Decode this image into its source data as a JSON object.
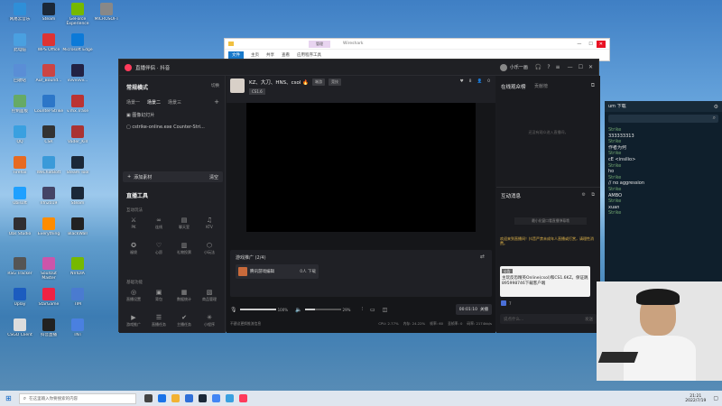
{
  "desktop_icons": [
    {
      "label": "网易云音乐"
    },
    {
      "label": "Steam"
    },
    {
      "label": "GeForce Experience"
    },
    {
      "label": "MICROSOFT"
    },
    {
      "label": "此电脑"
    },
    {
      "label": "WPS Office"
    },
    {
      "label": "Microsoft Edge"
    },
    {
      "label": "回收站"
    },
    {
      "label": "Aur_Bound..."
    },
    {
      "label": "vvvvvvv..."
    },
    {
      "label": "控制面板"
    },
    {
      "label": "Counter-Strike"
    },
    {
      "label": "v.mx.Trase"
    },
    {
      "label": "QQ"
    },
    {
      "label": "CSR"
    },
    {
      "label": "Vader_Kill"
    },
    {
      "label": "Firefox"
    },
    {
      "label": "WeChatBott"
    },
    {
      "label": "Steam Tool"
    },
    {
      "label": "Ubisoft"
    },
    {
      "label": "nfn2019"
    },
    {
      "label": "Steam"
    },
    {
      "label": "Obs Studio"
    },
    {
      "label": "Everything"
    },
    {
      "label": "BlackWall"
    },
    {
      "label": "RSG Tracker"
    },
    {
      "label": "SoulOut Master"
    },
    {
      "label": "NVIDIA"
    },
    {
      "label": "Uplay"
    },
    {
      "label": "StarGame"
    },
    {
      "label": "TIM"
    },
    {
      "label": "CSGO Client"
    },
    {
      "label": "抖音直播"
    },
    {
      "label": "TNT"
    }
  ],
  "explorer": {
    "title": "Wireshark",
    "tabs": [
      "文件",
      "主页",
      "共享",
      "查看",
      "应用程序工具"
    ],
    "manage_tab": "管理"
  },
  "app": {
    "title": "直播伴侣 · 抖音",
    "user": "小乐一画",
    "sidebar": {
      "mode_label": "常规横式",
      "switch_label": "切换",
      "scene_tabs": [
        "场景一",
        "场景二",
        "场景三"
      ],
      "sources": [
        "图像幻灯片",
        "cstrike-online.exe Counter-Stri..."
      ],
      "add_source": "添加素材",
      "clear_label": "清空",
      "live_tools_title": "直播工具",
      "interactive_title": "互动玩法",
      "tools_row1": [
        "PK",
        "连线",
        "聊天室",
        "KTV"
      ],
      "tools_row2": [
        "福袋",
        "心愿",
        "礼物投票",
        "小玩法"
      ],
      "general_title": "基础功能",
      "tools_row3": [
        "直播设置",
        "背包",
        "数据统计",
        "商品管理"
      ],
      "tools_row4": [
        "游戏推广",
        "直播任务",
        "主播任务",
        "小程序"
      ]
    },
    "stream_header": {
      "title": "KZ、大刀、HNS、csol 🔥",
      "tag1": "端游",
      "tag2": "竞技",
      "game": "CS1.6",
      "likes": "8",
      "viewers": "0"
    },
    "promo": {
      "title": "游戏推广 (2/4)",
      "item": "腾讯游戏编辑",
      "count": "0人 下载"
    },
    "controls": {
      "mic_volume": "100%",
      "speaker_volume": "29%",
      "duration": "00:01:10",
      "end_button": "关播"
    },
    "status": {
      "hint": "不建议更换推流信息",
      "cpu": "CPU: 2.77%",
      "memory": "内存: 24.22%",
      "frame": "帧率: 60",
      "drop": "丢帧率: 0",
      "bitrate": "码率: 2174kb/s"
    },
    "right_panel": {
      "audience_title": "在线观众榜",
      "contributor_tab": "贡献榜",
      "audience_empty": "还没有观众进入直播间，",
      "messages_title": "互动消息",
      "welcome_msg": "最小化窗口看直播弹幕哦",
      "chat_lines": [
        "欢迎来到直播间！抖音严禁未成年人直播或打赏，请理性消费。"
      ],
      "announce_badge": "公告",
      "announce": "主玩反恐精英Online(csol)和CS1.6KZ。保证跳895998746下载客户端",
      "input_placeholder": "说点什么...",
      "send_label": "发送",
      "viewer_num": "7"
    }
  },
  "terminal": {
    "header": "um 下载",
    "lines": [
      {
        "name": "Strike",
        "text": ""
      },
      {
        "name": "",
        "text": "333333313"
      },
      {
        "name": "Strike",
        "text": ""
      },
      {
        "name": "",
        "text": "作者为何"
      },
      {
        "name": "Strike",
        "text": ""
      },
      {
        "name": "",
        "text": "cE <insilio>"
      },
      {
        "name": "Strike",
        "text": ""
      },
      {
        "name": "",
        "text": "ho"
      },
      {
        "name": "Strike",
        "text": ""
      },
      {
        "name": "",
        "text": "// no aggression"
      },
      {
        "name": "Strike",
        "text": ""
      },
      {
        "name": "",
        "text": "AMBO"
      },
      {
        "name": "Strike",
        "text": ""
      },
      {
        "name": "",
        "text": "xuan"
      },
      {
        "name": "Strike",
        "text": ""
      }
    ]
  },
  "taskbar": {
    "search_placeholder": "在这里输入你要搜索的内容",
    "time": "21:21",
    "date": "2022/7/19"
  }
}
